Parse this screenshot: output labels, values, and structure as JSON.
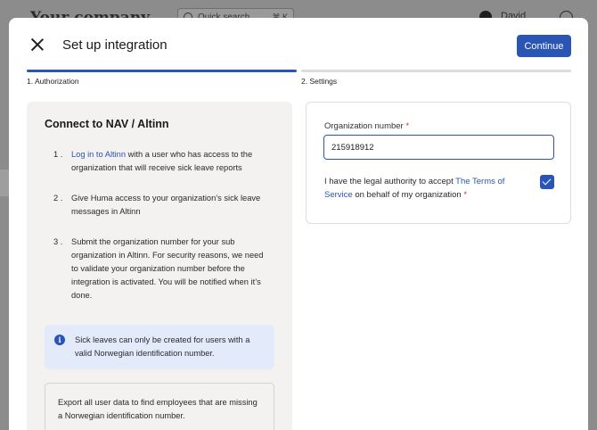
{
  "background": {
    "logo": "Your company",
    "search_placeholder": "Quick search...",
    "search_shortcut": "⌘ K",
    "user_name": "David"
  },
  "modal": {
    "title": "Set up integration",
    "continue_label": "Continue",
    "steps": [
      {
        "label": "1. Authorization",
        "active": true
      },
      {
        "label": "2. Settings",
        "active": false
      }
    ]
  },
  "left": {
    "title": "Connect to NAV / Altinn",
    "instructions": [
      {
        "num": "1 .",
        "link": "Log in to Altinn",
        "text": " with a user who has access to the organization that will receive sick leave reports"
      },
      {
        "num": "2 .",
        "text": "Give Huma access to your organization’s sick leave messages in Altinn"
      },
      {
        "num": "3 .",
        "text": "Submit the organization number for your sub organization in Altinn. For security reasons, we need to validate your organization number before the integration is activated. You will be notified when it’s done."
      }
    ],
    "info": "Sick leaves can only be created for users with a valid Norwegian identification number.",
    "export": "Export all user data to find employees that are missing a Norwegian identification number."
  },
  "right": {
    "org_label": "Organization number",
    "required_mark": " *",
    "org_value": "215918912",
    "consent_prefix": "I have the legal authority to accept ",
    "consent_link": "The Terms of Service",
    "consent_suffix": " on behalf of my organization",
    "consent_checked": true
  },
  "colors": {
    "accent": "#2a55b4",
    "info_bg": "#e3ebfb",
    "required": "#c0392b"
  }
}
